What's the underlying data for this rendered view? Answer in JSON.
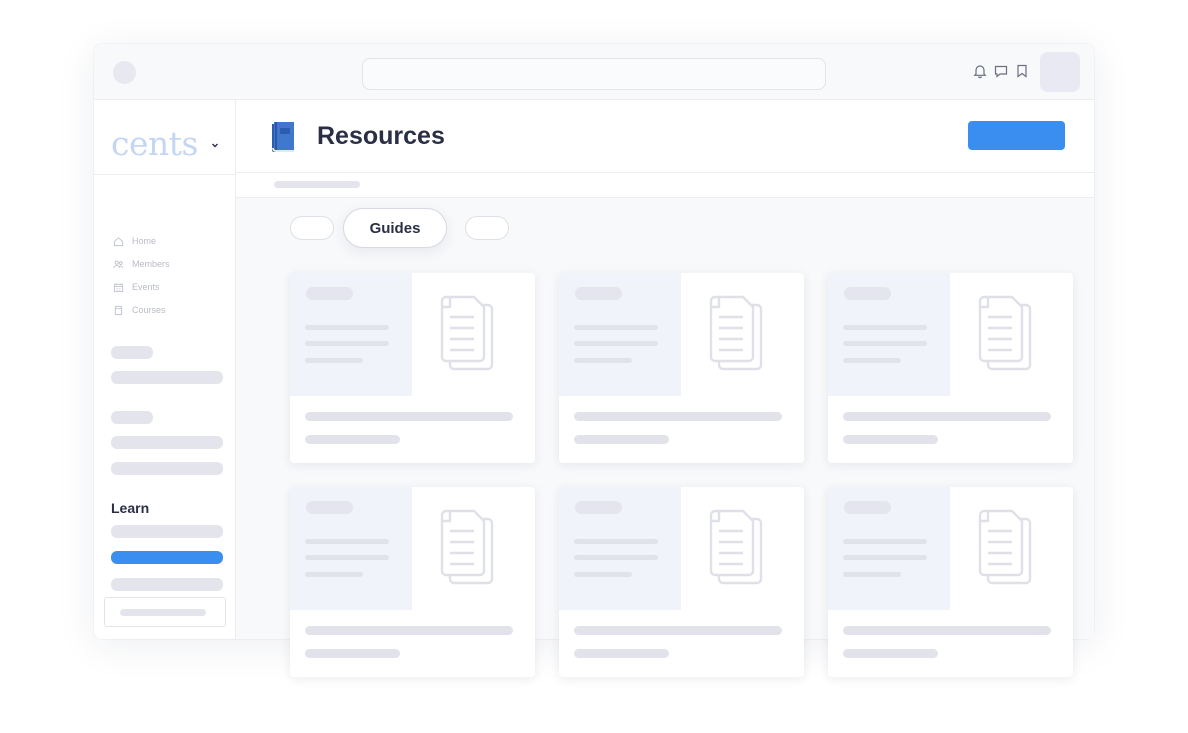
{
  "app": {
    "brand": "cents"
  },
  "sidebar": {
    "nav": [
      {
        "label": "Home",
        "icon": "home-icon"
      },
      {
        "label": "Members",
        "icon": "members-icon"
      },
      {
        "label": "Events",
        "icon": "calendar-icon"
      },
      {
        "label": "Courses",
        "icon": "courses-icon"
      }
    ],
    "section_title": "Learn"
  },
  "header": {
    "title": "Resources",
    "icon": "book-icon"
  },
  "tabs": {
    "active_label": "Guides"
  },
  "cards": [
    {
      "icon": "document-icon"
    },
    {
      "icon": "document-icon"
    },
    {
      "icon": "document-icon"
    },
    {
      "icon": "document-icon"
    },
    {
      "icon": "document-icon"
    },
    {
      "icon": "document-icon"
    }
  ],
  "colors": {
    "accent": "#3a8ef0",
    "brand": "#c5d6f4",
    "skeleton": "#e4e5ec",
    "text": "#2b2f45"
  }
}
